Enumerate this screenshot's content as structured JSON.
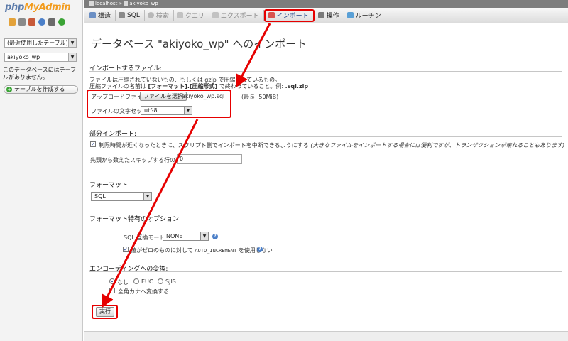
{
  "sidebar": {
    "logo_part1": "php",
    "logo_part2": "MyAdmin",
    "icons": [
      "home-icon",
      "sql-icon",
      "query-icon",
      "help-icon",
      "settings-icon",
      "reload-icon"
    ],
    "recent_table_select": "(最近使用したテーブル) ...",
    "database_select": "akiyoko_wp",
    "no_tables_note": "このデータベースにはテーブルがありません。",
    "create_table_button": "テーブルを作成する"
  },
  "breadcrumb": {
    "server": "localhost",
    "separator": "»",
    "database": "akiyoko_wp"
  },
  "tabs": [
    {
      "label": "構造",
      "icon": "structure-icon",
      "state": "normal"
    },
    {
      "label": "SQL",
      "icon": "sql-icon",
      "state": "normal"
    },
    {
      "label": "検索",
      "icon": "search-icon",
      "state": "disabled"
    },
    {
      "label": "クエリ",
      "icon": "query-icon",
      "state": "disabled"
    },
    {
      "label": "エクスポート",
      "icon": "export-icon",
      "state": "disabled"
    },
    {
      "label": "インポート",
      "icon": "import-icon",
      "state": "active"
    },
    {
      "label": "操作",
      "icon": "operations-icon",
      "state": "normal"
    },
    {
      "label": "ルーチン",
      "icon": "routines-icon",
      "state": "normal"
    }
  ],
  "page": {
    "title": "データベース \"akiyoko_wp\" へのインポート"
  },
  "import_file": {
    "title": "インポートするファイル:",
    "note1": "ファイルは圧縮されていないもの、もしくは gzip で圧縮されているもの。",
    "note2_a": "圧縮ファイルの名前は ",
    "note2_b": "[フォーマット].[圧縮形式]",
    "note2_c": " で終わっていること。例: ",
    "note2_d": ".sql.zip",
    "upload_label": "アップロードファイル:",
    "choose_button": "ファイルを選択",
    "file_name": "akiyoko_wp.sql",
    "max_size": "(最長: 50MiB)",
    "charset_label": "ファイルの文字セット:",
    "charset_value": "utf-8"
  },
  "partial_import": {
    "title": "部分インポート:",
    "allow_interrupt_label": "制限時間が近くなったときに、スクリプト側でインポートを中断できるようにする",
    "allow_interrupt_note": " (大きなファイルをインポートする場合には便利ですが、トランザクションが壊れることもあります)",
    "skip_label": "先頭から数えたスキップする行の数:",
    "skip_value": "0"
  },
  "format": {
    "title": "フォーマット:",
    "value": "SQL"
  },
  "format_options": {
    "title": "フォーマット特有のオプション:",
    "compat_label": "SQL 互換モード",
    "compat_value": "NONE",
    "auto_increment_prefix": "値がゼロのものに対して ",
    "auto_increment_code": "AUTO_INCREMENT",
    "auto_increment_suffix": " を使用しない"
  },
  "encoding": {
    "title": "エンコーディングへの変換:",
    "options": [
      "なし",
      "EUC",
      "SJIS"
    ],
    "selected": "なし",
    "kana_label": "全角カナへ変換する"
  },
  "submit": {
    "label": "実行"
  },
  "annotation_color": "#e60000"
}
